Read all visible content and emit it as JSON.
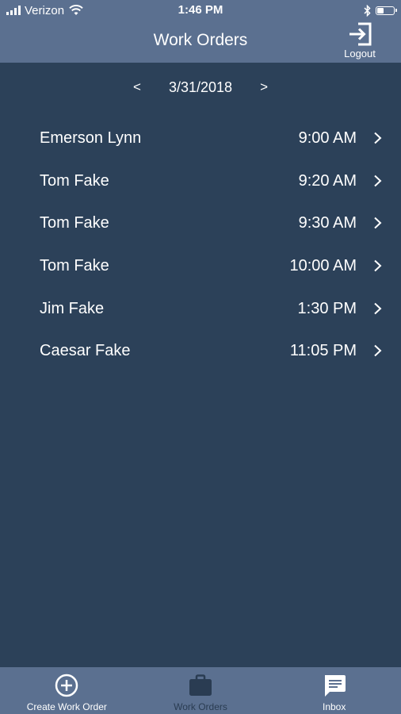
{
  "status_bar": {
    "carrier": "Verizon",
    "time": "1:46 PM",
    "icons": [
      "signal-bars-icon",
      "wifi-icon",
      "bluetooth-icon",
      "battery-icon"
    ]
  },
  "header": {
    "title": "Work Orders",
    "logout_label": "Logout",
    "logout_icon": "logout-arrow-icon"
  },
  "date_nav": {
    "prev": "<",
    "date": "3/31/2018",
    "next": ">"
  },
  "orders": [
    {
      "name": "Emerson Lynn",
      "time": "9:00 AM"
    },
    {
      "name": "Tom Fake",
      "time": "9:20 AM"
    },
    {
      "name": "Tom Fake",
      "time": "9:30 AM"
    },
    {
      "name": "Tom Fake",
      "time": "10:00 AM"
    },
    {
      "name": "Jim Fake",
      "time": "1:30 PM"
    },
    {
      "name": "Caesar Fake",
      "time": "11:05 PM"
    }
  ],
  "tabbar": {
    "tabs": [
      {
        "label": "Create Work Order",
        "icon": "plus-circle-icon",
        "active": false
      },
      {
        "label": "Work Orders",
        "icon": "briefcase-icon",
        "active": true
      },
      {
        "label": "Inbox",
        "icon": "message-icon",
        "active": false
      }
    ]
  },
  "colors": {
    "background": "#2c4159",
    "bar": "#5b7090",
    "text": "#ffffff",
    "active_tab": "#2a3c52"
  }
}
